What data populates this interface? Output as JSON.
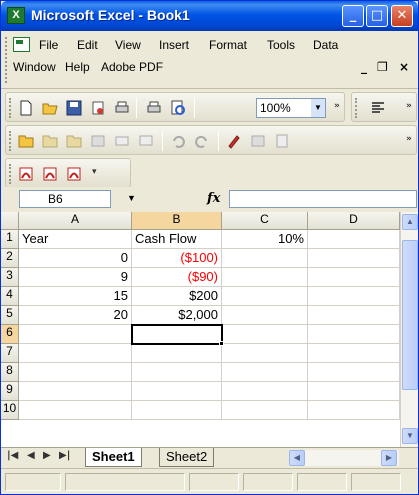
{
  "window": {
    "title": "Microsoft Excel - Book1",
    "app_icon": "excel-icon",
    "minimize_glyph": "_",
    "maximize_glyph": "□",
    "close_glyph": "✕"
  },
  "menu": {
    "row1": [
      "File",
      "Edit",
      "View",
      "Insert",
      "Format",
      "Tools",
      "Data"
    ],
    "row2": [
      "Window",
      "Help",
      "Adobe PDF"
    ],
    "mdi_min": "_",
    "mdi_restore": "❐",
    "mdi_close": "×"
  },
  "toolbar": {
    "zoom": "100%",
    "icons": [
      "new-icon",
      "open-icon",
      "save-icon",
      "permission-icon",
      "print-icon",
      "print-preview-icon",
      "align-icon"
    ],
    "icons2": [
      "review-icon",
      "reply-icon",
      "send-icon",
      "track-icon",
      "mail-icon",
      "comment-icon",
      "undo-icon",
      "redo-icon",
      "ink-icon",
      "pdf-icon"
    ],
    "pdf_icons": [
      "pdf-convert-icon",
      "pdf-email-icon",
      "pdf-review-icon"
    ]
  },
  "formula_bar": {
    "name_box": "B6",
    "fx_label": "fx",
    "formula": ""
  },
  "sheet": {
    "columns": [
      "A",
      "B",
      "C",
      "D"
    ],
    "rows": [
      "1",
      "2",
      "3",
      "4",
      "5",
      "6",
      "7",
      "8",
      "9",
      "10"
    ],
    "cells": {
      "A1": "Year",
      "B1": "Cash Flow",
      "C1": "10%",
      "A2": "0",
      "B2": "($100)",
      "A3": "9",
      "B3": "($90)",
      "A4": "15",
      "B4": "$200",
      "A5": "20",
      "B5": "$2,000"
    },
    "active_cell": "B6",
    "negative_color": "#ff0000"
  },
  "tabs": {
    "sheets": [
      "Sheet1",
      "Sheet2"
    ],
    "active": "Sheet1"
  }
}
